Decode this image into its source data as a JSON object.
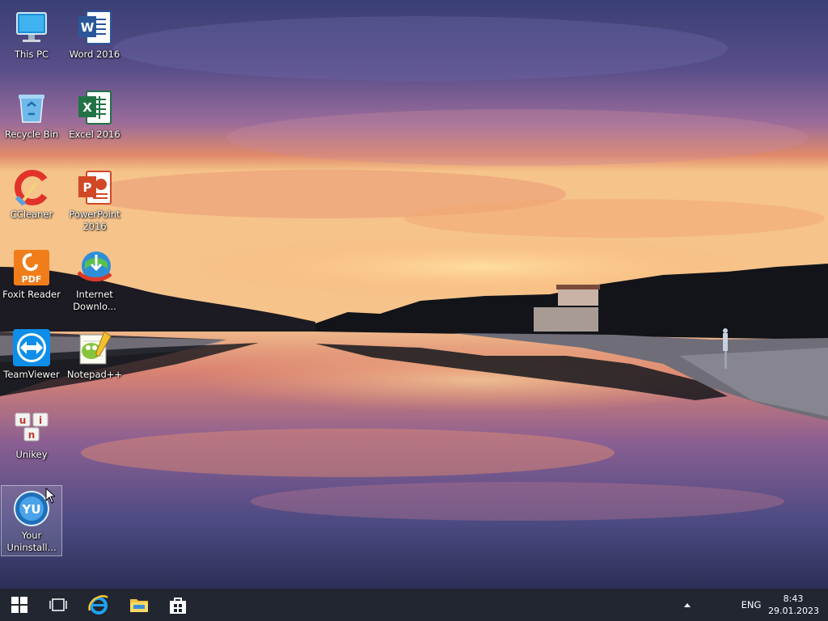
{
  "desktop": {
    "icons": [
      {
        "label": "This PC",
        "icon": "this-pc-icon"
      },
      {
        "label": "Word 2016",
        "icon": "word-icon"
      },
      {
        "label": "Recycle Bin",
        "icon": "recycle-bin-icon"
      },
      {
        "label": "Excel 2016",
        "icon": "excel-icon"
      },
      {
        "label": "CCleaner",
        "icon": "ccleaner-icon"
      },
      {
        "label": "PowerPoint 2016",
        "icon": "powerpoint-icon"
      },
      {
        "label": "Foxit Reader",
        "icon": "foxit-reader-icon"
      },
      {
        "label": "Internet Downlo...",
        "icon": "internet-download-manager-icon"
      },
      {
        "label": "TeamViewer",
        "icon": "teamviewer-icon"
      },
      {
        "label": "Notepad++",
        "icon": "notepad-plus-plus-icon"
      },
      {
        "label": "Unikey",
        "icon": "unikey-icon"
      },
      {
        "label": "Your Uninstall...",
        "icon": "your-uninstaller-icon"
      }
    ],
    "icon_glyph_text": {
      "word": "W",
      "excel": "X",
      "powerpoint": "P",
      "foxit": "PDF",
      "unikey": [
        "u",
        "i",
        "n"
      ],
      "your_uninstaller": "YU"
    },
    "wallpaper": "sunset-lake"
  },
  "taskbar": {
    "buttons": [
      {
        "name": "start-button",
        "icon": "windows-logo-icon"
      },
      {
        "name": "task-view-button",
        "icon": "task-view-icon"
      },
      {
        "name": "internet-explorer-button",
        "icon": "internet-explorer-icon"
      },
      {
        "name": "file-explorer-button",
        "icon": "folder-icon"
      },
      {
        "name": "store-button",
        "icon": "store-icon"
      }
    ],
    "tray": {
      "language": "ENG",
      "time": "8:43",
      "date": "29.01.2023"
    }
  },
  "colors": {
    "taskbar_bg": "#101621",
    "word": "#2b579a",
    "excel": "#217346",
    "powerpoint": "#d24726",
    "foxit": "#f07d1a",
    "teamviewer": "#0e8ee9"
  }
}
